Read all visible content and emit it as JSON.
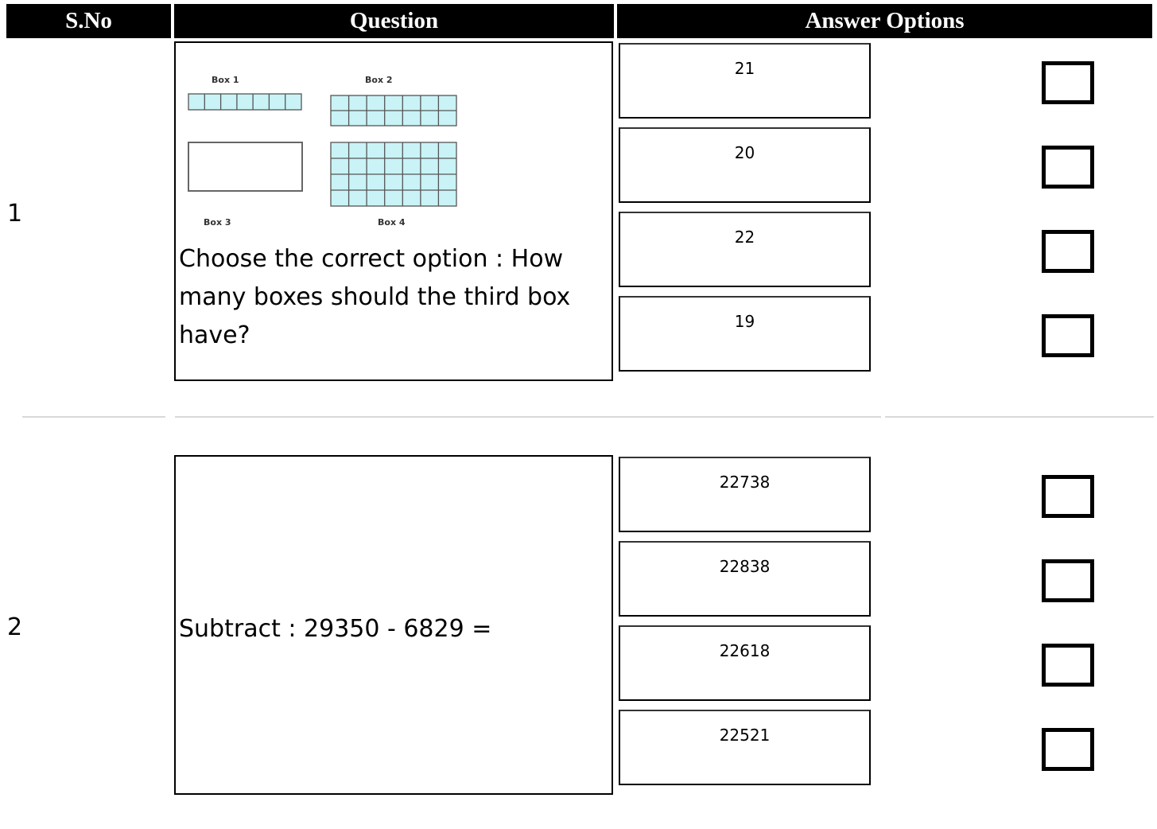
{
  "header": {
    "sno": "S.No",
    "question": "Question",
    "answers": "Answer Options"
  },
  "questions": [
    {
      "number": "1",
      "figure": {
        "labels": [
          "Box 1",
          "Box 2",
          "Box 3",
          "Box 4"
        ],
        "cell_color": "#c9f3f6"
      },
      "text": "Choose the correct option : How many boxes should the third box have?",
      "options": [
        "21",
        "20",
        "22",
        "19"
      ]
    },
    {
      "number": "2",
      "text": "Subtract : 29350 - 6829 =",
      "options": [
        "22738",
        "22838",
        "22618",
        "22521"
      ]
    }
  ]
}
